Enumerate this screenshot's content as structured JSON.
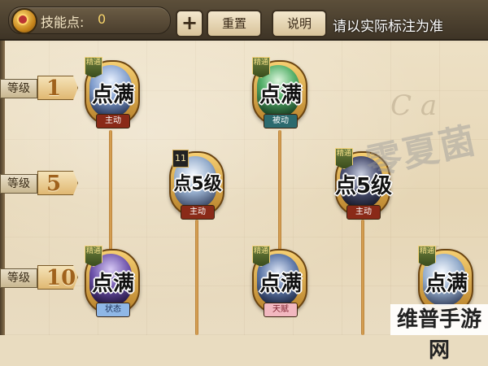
{
  "header": {
    "skill_points_label": "技能点:",
    "skill_points_value": "0",
    "add_label": "+",
    "reset_label": "重置",
    "explain_label": "说明",
    "note": "请以实际标注为准"
  },
  "levels": [
    {
      "tag": "等级",
      "value": "1"
    },
    {
      "tag": "等级",
      "value": "5"
    },
    {
      "tag": "等级",
      "value": "10"
    }
  ],
  "skills": [
    {
      "badge": "精通",
      "status": "点满",
      "type": "主动",
      "icon": "ice-spirit-icon"
    },
    {
      "badge": "精通",
      "status": "点满",
      "type": "被动",
      "icon": "green-spirit-icon"
    },
    {
      "badge": "11",
      "status": "点5级",
      "type": "主动",
      "icon": "frost-claw-icon"
    },
    {
      "badge": "精通",
      "status": "点5级",
      "type": "主动",
      "icon": "shadow-beast-icon"
    },
    {
      "badge": "精通",
      "status": "点满",
      "type": "状态",
      "icon": "purple-veil-icon"
    },
    {
      "badge": "精通",
      "status": "点满",
      "type": "天赋",
      "icon": "blue-arch-icon"
    },
    {
      "badge": "精通",
      "status": "点满",
      "type": "",
      "icon": "frost-wing-icon"
    }
  ],
  "watermarks": {
    "overlay": "零夏菌",
    "corner": "维普手游网"
  },
  "colors": {
    "active": "#8a2a18",
    "passive": "#2c6a6e",
    "state": "#8fb7e6",
    "talent": "#f2b8c0",
    "level_number": "#a0621c"
  }
}
